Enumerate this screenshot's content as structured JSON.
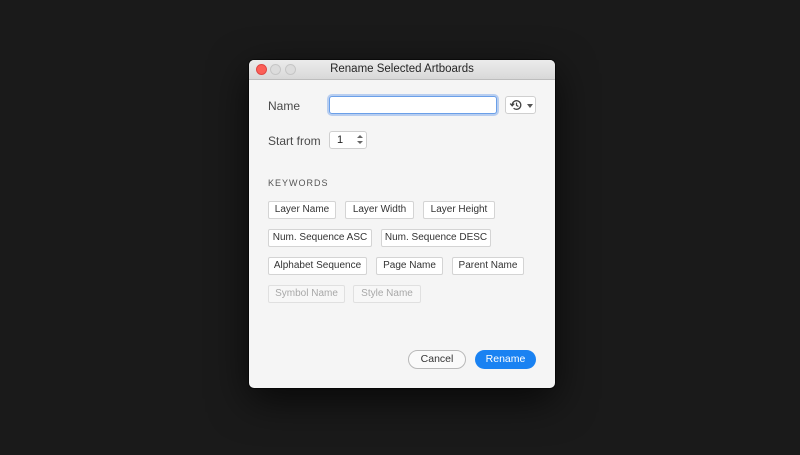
{
  "dialog": {
    "title": "Rename Selected Artboards",
    "name_label": "Name",
    "name_value": "",
    "start_label": "Start from",
    "start_value": "1",
    "keywords_heading": "KEYWORDS",
    "keywords": [
      {
        "label": "Layer Name",
        "enabled": true
      },
      {
        "label": "Layer Width",
        "enabled": true
      },
      {
        "label": "Layer Height",
        "enabled": true
      },
      {
        "label": "Num. Sequence ASC",
        "enabled": true
      },
      {
        "label": "Num. Sequence DESC",
        "enabled": true
      },
      {
        "label": "Alphabet Sequence",
        "enabled": true
      },
      {
        "label": "Page Name",
        "enabled": true
      },
      {
        "label": "Parent Name",
        "enabled": true
      },
      {
        "label": "Symbol Name",
        "enabled": false
      },
      {
        "label": "Style Name",
        "enabled": false
      }
    ],
    "cancel_label": "Cancel",
    "rename_label": "Rename",
    "history_icon": "history-clock-icon"
  },
  "colors": {
    "background": "#1a1a1a",
    "dialog_bg": "#f5f5f5",
    "accent": "#1a82f2",
    "close_button": "#fc5f57",
    "focus_ring": "#6a9fe8"
  }
}
